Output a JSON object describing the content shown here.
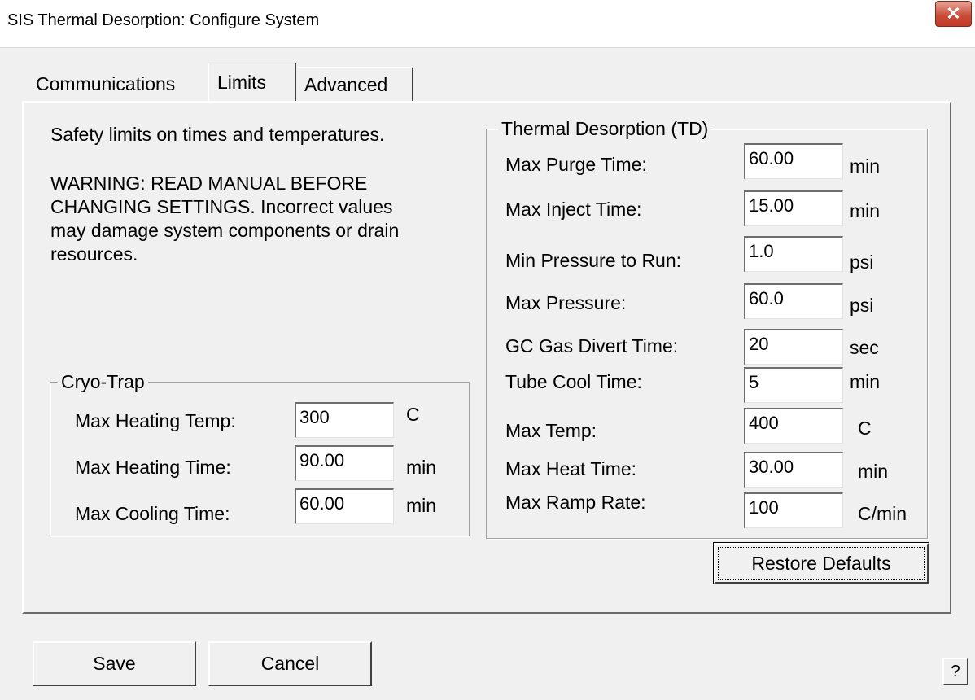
{
  "window": {
    "title": "SIS Thermal Desorption: Configure System",
    "close_symbol": "✕"
  },
  "tabs": [
    {
      "label": "Communications",
      "selected": false
    },
    {
      "label": "Limits",
      "selected": true
    },
    {
      "label": "Advanced",
      "selected": false
    }
  ],
  "intro": {
    "text": "Safety limits on times and temperatures.",
    "warning_lines": [
      "WARNING: READ MANUAL BEFORE",
      "CHANGING SETTINGS. Incorrect values",
      "may damage system components or drain",
      "resources."
    ]
  },
  "cryo_trap": {
    "title": "Cryo-Trap",
    "fields": [
      {
        "label": "Max Heating Temp:",
        "value": "300",
        "unit": "C"
      },
      {
        "label": "Max Heating Time:",
        "value": "90.00",
        "unit": "min"
      },
      {
        "label": "Max Cooling Time:",
        "value": "60.00",
        "unit": "min"
      }
    ]
  },
  "td": {
    "title": "Thermal Desorption (TD)",
    "fields": [
      {
        "label": "Max Purge Time:",
        "value": "60.00",
        "unit": "min"
      },
      {
        "label": "Max Inject Time:",
        "value": "15.00",
        "unit": "min"
      },
      {
        "label": "Min Pressure to Run:",
        "value": "1.0",
        "unit": "psi"
      },
      {
        "label": "Max Pressure:",
        "value": "60.0",
        "unit": "psi"
      },
      {
        "label": "GC Gas Divert Time:",
        "value": "20",
        "unit": "sec"
      },
      {
        "label": "Tube Cool Time:",
        "value": "5",
        "unit": "min"
      },
      {
        "label": "Max Temp:",
        "value": "400",
        "unit": "C"
      },
      {
        "label": "Max Heat Time:",
        "value": "30.00",
        "unit": "min"
      },
      {
        "label": "Max Ramp Rate:",
        "value": "100",
        "unit": "C/min"
      }
    ]
  },
  "buttons": {
    "restore_defaults": "Restore Defaults",
    "save": "Save",
    "cancel": "Cancel",
    "help": "?"
  }
}
